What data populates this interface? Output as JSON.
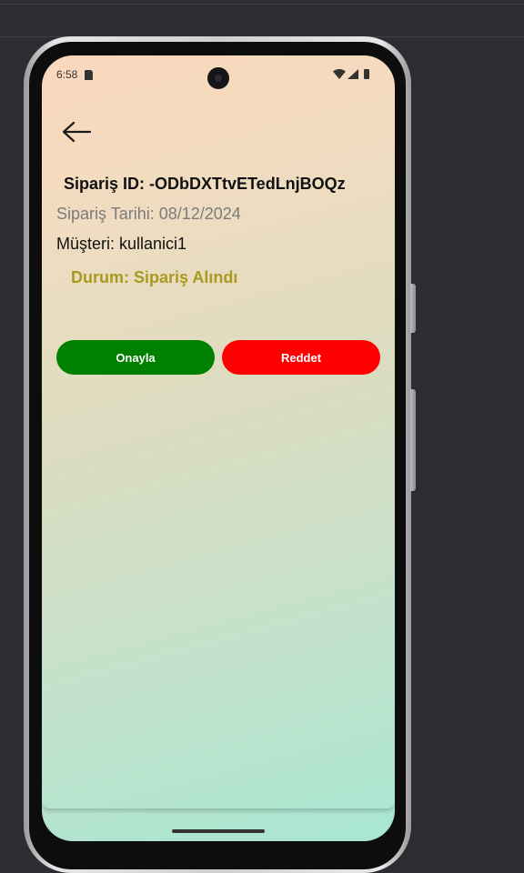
{
  "status_bar": {
    "time": "6:58",
    "icons": [
      "sd-card-icon",
      "wifi-icon",
      "signal-icon",
      "battery-icon"
    ]
  },
  "order": {
    "id_label": "Sipariş ID: -ODbDXTtvETedLnjBOQz",
    "date_label": "Sipariş Tarihi: 08/12/2024",
    "customer_label": "Müşteri: kullanici1",
    "status_label": "Durum: Sipariş Alındı"
  },
  "actions": {
    "approve_label": "Onayla",
    "reject_label": "Reddet"
  },
  "colors": {
    "approve": "#008000",
    "reject": "#ff0000",
    "status": "#a99a1f",
    "gradient_top": "#fbd8bd",
    "gradient_bottom": "#a8e6d1"
  },
  "navigation": {
    "back_icon": "arrow-left-icon"
  }
}
